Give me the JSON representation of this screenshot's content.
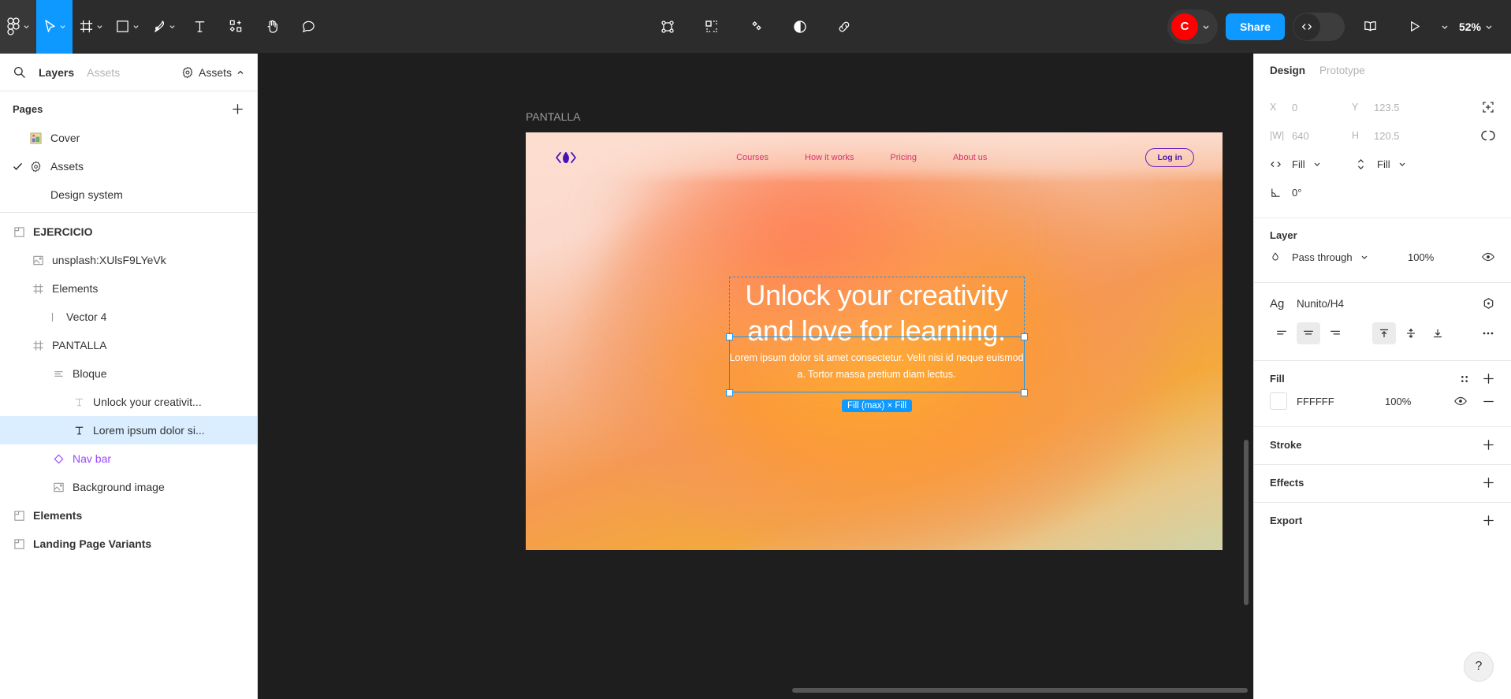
{
  "toolbar": {
    "menu_icon": "figma-logo-icon",
    "tools": [
      {
        "name": "figma-menu",
        "icon": "figma-logo-icon",
        "has_chevron": true,
        "active": false
      },
      {
        "name": "move-tool",
        "icon": "cursor-icon",
        "has_chevron": true,
        "active": true
      },
      {
        "name": "frame-tool",
        "icon": "frame-icon",
        "has_chevron": true,
        "active": false
      },
      {
        "name": "shape-tool",
        "icon": "rectangle-icon",
        "has_chevron": true,
        "active": false
      },
      {
        "name": "pen-tool",
        "icon": "pen-icon",
        "has_chevron": true,
        "active": false
      },
      {
        "name": "text-tool",
        "icon": "text-T-icon",
        "has_chevron": false,
        "active": false
      },
      {
        "name": "actions-tool",
        "icon": "resources-icon",
        "has_chevron": false,
        "active": false
      },
      {
        "name": "hand-tool",
        "icon": "hand-icon",
        "has_chevron": false,
        "active": false
      },
      {
        "name": "comment-tool",
        "icon": "comment-icon",
        "has_chevron": false,
        "active": false
      }
    ],
    "center_tools": [
      {
        "name": "vector-edit",
        "icon": "vector-node-icon"
      },
      {
        "name": "component-tool",
        "icon": "component-grid-icon"
      },
      {
        "name": "plugins",
        "icon": "diamonds-icon"
      },
      {
        "name": "mask",
        "icon": "contrast-circle-icon"
      },
      {
        "name": "link",
        "icon": "link-icon"
      }
    ],
    "avatar_initial": "C",
    "avatar_color": "#ff0000",
    "share_label": "Share",
    "devmode_icon": "code-brackets-icon",
    "book_icon": "book-icon",
    "present_icon": "play-icon",
    "zoom_level": "52%"
  },
  "left_panel": {
    "search_icon": "search-icon",
    "tabs": [
      {
        "label": "Layers",
        "active": true
      },
      {
        "label": "Assets",
        "active": false
      }
    ],
    "file_dropdown": {
      "label": "Assets",
      "icon": "gear-icon",
      "chevron": "chevron-up-icon"
    },
    "pages": {
      "title": "Pages",
      "add_icon": "plus-icon",
      "items": [
        {
          "label": "Cover",
          "icon": "image-thumb-icon",
          "selected": false
        },
        {
          "label": "Assets",
          "icon": "gear-icon",
          "selected": true
        },
        {
          "label": "Design system",
          "icon": "none",
          "selected": false
        }
      ]
    },
    "layers": [
      {
        "label": "EJERCICIO",
        "icon": "section-icon",
        "indent": 0,
        "bold": true,
        "component": false,
        "selected": false
      },
      {
        "label": "unsplash:XUlsF9LYeVk",
        "icon": "image-icon",
        "indent": 1,
        "bold": false,
        "component": false,
        "selected": false
      },
      {
        "label": "Elements",
        "icon": "frame-icon",
        "indent": 1,
        "bold": false,
        "component": false,
        "selected": false
      },
      {
        "label": "Vector 4",
        "icon": "vector-line-icon",
        "indent": 2,
        "bold": false,
        "component": false,
        "selected": false
      },
      {
        "label": "PANTALLA",
        "icon": "frame-icon",
        "indent": 1,
        "bold": false,
        "component": false,
        "selected": false
      },
      {
        "label": "Bloque",
        "icon": "autolayout-icon",
        "indent": 2,
        "bold": false,
        "component": false,
        "selected": false
      },
      {
        "label": "Unlock your creativit...",
        "icon": "text-icon",
        "indent": 3,
        "bold": false,
        "component": false,
        "selected": false
      },
      {
        "label": "Lorem ipsum dolor si...",
        "icon": "text-icon",
        "indent": 3,
        "bold": false,
        "component": false,
        "selected": true
      },
      {
        "label": "Nav bar",
        "icon": "instance-icon",
        "indent": 2,
        "bold": false,
        "component": true,
        "selected": false
      },
      {
        "label": "Background image",
        "icon": "image-icon",
        "indent": 2,
        "bold": false,
        "component": false,
        "selected": false
      },
      {
        "label": "Elements",
        "icon": "section-icon",
        "indent": 0,
        "bold": true,
        "component": false,
        "selected": false
      },
      {
        "label": "Landing Page Variants",
        "icon": "section-icon",
        "indent": 0,
        "bold": true,
        "component": false,
        "selected": false
      }
    ]
  },
  "canvas": {
    "frame_label": "PANTALLA",
    "design": {
      "logo_icon": "flame-brackets-logo",
      "nav_links": [
        "Courses",
        "How it works",
        "Pricing",
        "About us"
      ],
      "login_label": "Log in",
      "heading": "Unlock your creativity and love for learning.",
      "paragraph": "Lorem ipsum dolor sit amet consectetur. Velit nisi id neque euismod a. Tortor massa pretium diam lectus."
    },
    "selection_badge": "Fill (max) × Fill"
  },
  "right_panel": {
    "tabs": [
      {
        "label": "Design",
        "active": true
      },
      {
        "label": "Prototype",
        "active": false
      }
    ],
    "position": {
      "x_label": "X",
      "x_value": "0",
      "y_label": "Y",
      "y_value": "123.5",
      "w_label": "|W|",
      "w_value": "640",
      "h_label": "H",
      "h_value": "120.5",
      "horizontal_resize": "Fill",
      "vertical_resize": "Fill",
      "rotation": "0°",
      "align_icon": "align-tool-icon",
      "constraint_icon": "corner-radius-icon"
    },
    "layer": {
      "title": "Layer",
      "blend_mode": "Pass through",
      "opacity": "100%",
      "visibility_icon": "eye-icon",
      "blend_icon": "blend-drop-icon"
    },
    "text": {
      "style_prefix": "Ag",
      "style_name": "Nunito/H4",
      "style_icon": "style-hexagon-icon",
      "h_aligns": [
        {
          "name": "align-left",
          "active": false
        },
        {
          "name": "align-center",
          "active": true
        },
        {
          "name": "align-right",
          "active": false
        }
      ],
      "v_aligns": [
        {
          "name": "align-top",
          "active": true
        },
        {
          "name": "align-middle",
          "active": false
        },
        {
          "name": "align-bottom",
          "active": false
        }
      ],
      "more_icon": "more-options-icon"
    },
    "fill": {
      "title": "Fill",
      "hex": "FFFFFF",
      "opacity": "100%",
      "color": "#FFFFFF",
      "styles_icon": "style-dots-icon",
      "add_icon": "plus-icon",
      "visibility_icon": "eye-icon",
      "remove_icon": "minus-icon"
    },
    "stroke": {
      "title": "Stroke",
      "add_icon": "plus-icon"
    },
    "effects": {
      "title": "Effects",
      "add_icon": "plus-icon"
    },
    "export": {
      "title": "Export",
      "add_icon": "plus-icon"
    }
  },
  "help_label": "?"
}
